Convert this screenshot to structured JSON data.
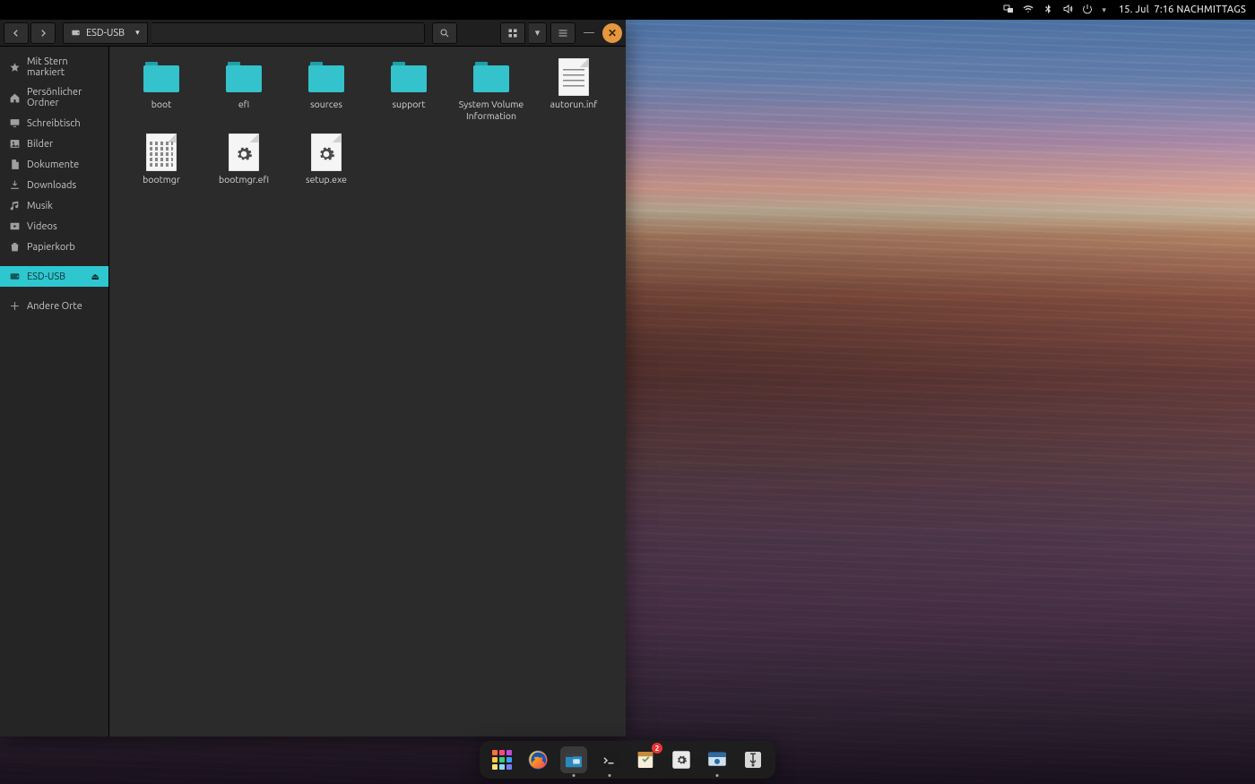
{
  "topbar": {
    "date": "15. Jul",
    "time": "7:16",
    "period": "NACHMITTAGS"
  },
  "window": {
    "location_label": "ESD-USB"
  },
  "sidebar": {
    "items": [
      {
        "id": "starred",
        "label": "Mit Stern markiert"
      },
      {
        "id": "home",
        "label": "Persönlicher Ordner"
      },
      {
        "id": "desktop",
        "label": "Schreibtisch"
      },
      {
        "id": "pictures",
        "label": "Bilder"
      },
      {
        "id": "documents",
        "label": "Dokumente"
      },
      {
        "id": "downloads",
        "label": "Downloads"
      },
      {
        "id": "music",
        "label": "Musik"
      },
      {
        "id": "videos",
        "label": "Videos"
      },
      {
        "id": "trash",
        "label": "Papierkorb"
      }
    ],
    "mounted": {
      "id": "esd-usb",
      "label": "ESD-USB"
    },
    "other": {
      "id": "other",
      "label": "Andere Orte"
    }
  },
  "files": [
    {
      "name": "boot",
      "type": "folder"
    },
    {
      "name": "efi",
      "type": "folder"
    },
    {
      "name": "sources",
      "type": "folder"
    },
    {
      "name": "support",
      "type": "folder"
    },
    {
      "name": "System Volume Information",
      "type": "folder"
    },
    {
      "name": "autorun.inf",
      "type": "textfile"
    },
    {
      "name": "bootmgr",
      "type": "hexfile"
    },
    {
      "name": "bootmgr.efi",
      "type": "exefile"
    },
    {
      "name": "setup.exe",
      "type": "exefile"
    }
  ],
  "dock": {
    "items": [
      {
        "id": "apps",
        "kind": "appgrid"
      },
      {
        "id": "firefox",
        "kind": "firefox"
      },
      {
        "id": "files",
        "kind": "files",
        "running": true,
        "active": true
      },
      {
        "id": "terminal",
        "kind": "terminal",
        "running": true
      },
      {
        "id": "software",
        "kind": "software",
        "badge": "2"
      },
      {
        "id": "settings",
        "kind": "settings"
      },
      {
        "id": "screenshot",
        "kind": "screenshot",
        "running": true
      },
      {
        "id": "usbwriter",
        "kind": "usb"
      }
    ]
  }
}
